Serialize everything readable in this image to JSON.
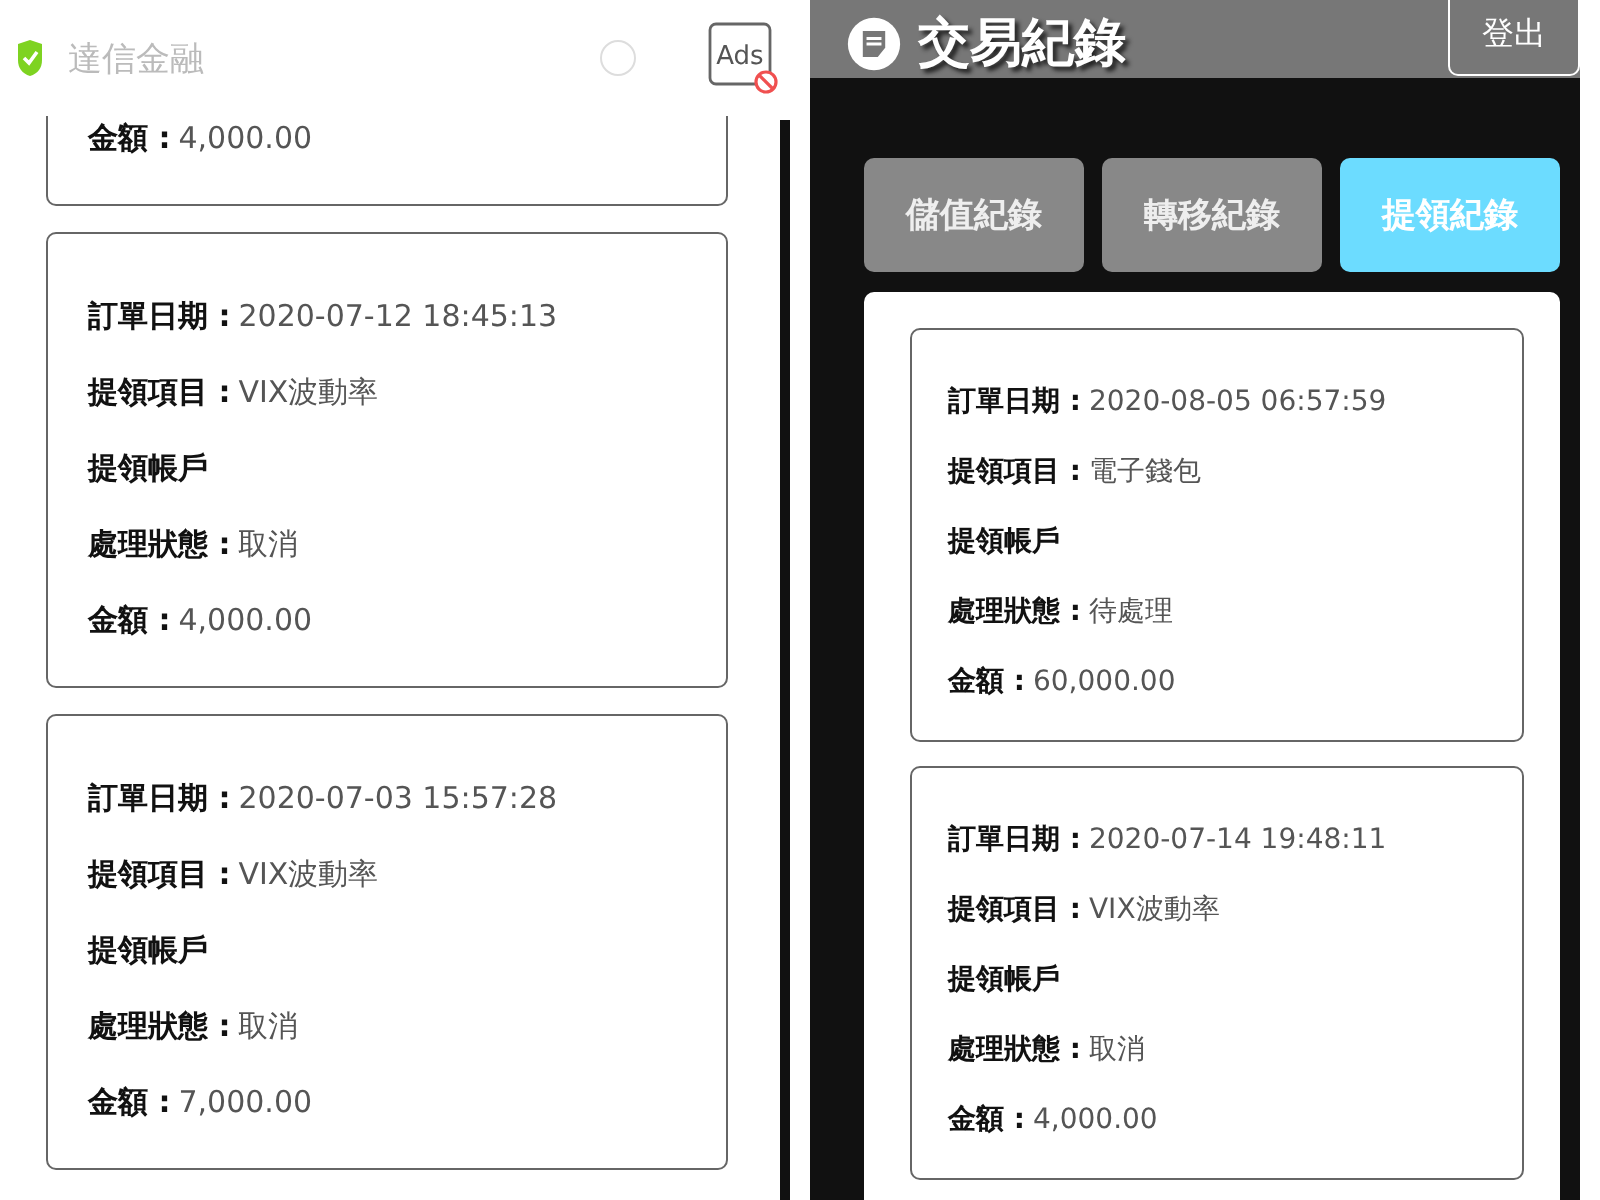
{
  "left_app": {
    "title": "達信金融",
    "ads_label": "Ads",
    "cards": [
      {
        "fields": [
          {
            "label": "金額 :",
            "value": "4,000.00"
          }
        ]
      },
      {
        "fields": [
          {
            "label": "訂單日期 :",
            "value": "2020-07-12 18:45:13"
          },
          {
            "label": "提領項目 :",
            "value": "VIX波動率"
          },
          {
            "label": "提領帳戶"
          },
          {
            "label": "處理狀態 :",
            "value": "取消"
          },
          {
            "label": "金額 :",
            "value": "4,000.00"
          }
        ]
      },
      {
        "fields": [
          {
            "label": "訂單日期 :",
            "value": "2020-07-03 15:57:28"
          },
          {
            "label": "提領項目 :",
            "value": "VIX波動率"
          },
          {
            "label": "提領帳戶"
          },
          {
            "label": "處理狀態 :",
            "value": "取消"
          },
          {
            "label": "金額 :",
            "value": "7,000.00"
          }
        ]
      }
    ]
  },
  "right_app": {
    "title": "交易紀錄",
    "logout": "登出",
    "tabs": [
      {
        "label": "儲值紀錄",
        "selected": false
      },
      {
        "label": "轉移紀錄",
        "selected": false
      },
      {
        "label": "提領紀錄",
        "selected": true
      }
    ],
    "cards": [
      {
        "fields": [
          {
            "label": "訂單日期 :",
            "value": "2020-08-05 06:57:59"
          },
          {
            "label": "提領項目 :",
            "value": "電子錢包"
          },
          {
            "label": "提領帳戶"
          },
          {
            "label": "處理狀態 :",
            "value": "待處理"
          },
          {
            "label": "金額 :",
            "value": "60,000.00"
          }
        ]
      },
      {
        "fields": [
          {
            "label": "訂單日期 :",
            "value": "2020-07-14 19:48:11"
          },
          {
            "label": "提領項目 :",
            "value": "VIX波動率"
          },
          {
            "label": "提領帳戶"
          },
          {
            "label": "處理狀態 :",
            "value": "取消"
          },
          {
            "label": "金額 :",
            "value": "4,000.00"
          }
        ]
      }
    ]
  }
}
